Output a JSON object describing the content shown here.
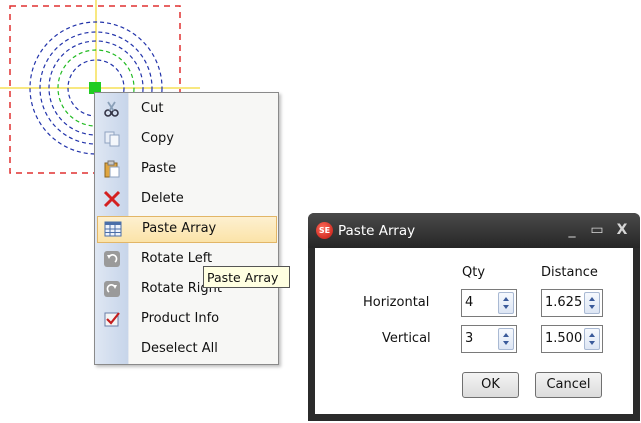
{
  "context_menu": {
    "items": [
      {
        "label": "Cut",
        "icon": "scissors-icon"
      },
      {
        "label": "Copy",
        "icon": "copy-icon"
      },
      {
        "label": "Paste",
        "icon": "clipboard-icon"
      },
      {
        "label": "Delete",
        "icon": "red-x-icon"
      },
      {
        "label": "Paste Array",
        "icon": "grid-icon",
        "highlighted": true
      },
      {
        "label": "Rotate Left",
        "icon": "rotate-left-icon"
      },
      {
        "label": "Rotate Right",
        "icon": "rotate-right-icon"
      },
      {
        "label": "Product Info",
        "icon": "checkbox-icon"
      },
      {
        "label": "Deselect All",
        "icon": ""
      }
    ]
  },
  "tooltip": {
    "text": "Paste Array"
  },
  "dialog": {
    "title": "Paste Array",
    "app_icon_text": "SE",
    "col_qty": "Qty",
    "col_distance": "Distance",
    "rows": [
      {
        "label": "Horizontal",
        "qty": "4",
        "distance": "1.625"
      },
      {
        "label": "Vertical",
        "qty": "3",
        "distance": "1.500"
      }
    ],
    "ok_label": "OK",
    "cancel_label": "Cancel",
    "minimize_glyph": "_",
    "maximize_glyph": "▭",
    "close_glyph": "X"
  },
  "colors": {
    "selection_box": "#e03030",
    "circle_outer": "#2233aa",
    "circle_inner": "#22bb22",
    "crosshair": "#f0d000",
    "handle": "#22cc22"
  }
}
